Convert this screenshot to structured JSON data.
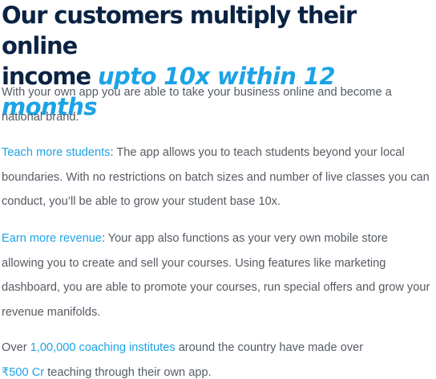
{
  "heading": {
    "line1": "Our customers multiply their online",
    "line2_plain": "income",
    "line2_highlight": "upto 10x within 12 months"
  },
  "intro": {
    "text": "With your own app you are able to take your business online and become a national brand."
  },
  "teach": {
    "label": "Teach more students",
    "text": ": The app allows you to teach students beyond your local boundaries. With no restrictions on batch sizes and number of live classes you can conduct, you’ll be able to grow your student base 10x."
  },
  "earn": {
    "label": "Earn more revenue",
    "text": ": Your app also functions as your very own mobile store allowing you to create and sell your courses. Using features like marketing dashboard, you are able to promote your courses, run special offers and grow your revenue manifolds."
  },
  "stats": {
    "prefix": "Over",
    "institutes": "1,00,000 coaching institutes",
    "middle": "around the country have made over",
    "amount": "₹500 Cr",
    "suffix": "teaching through their own app."
  },
  "colors": {
    "heading": "#0b2343",
    "accent": "#1ca3e6",
    "body_text": "#555b63"
  }
}
